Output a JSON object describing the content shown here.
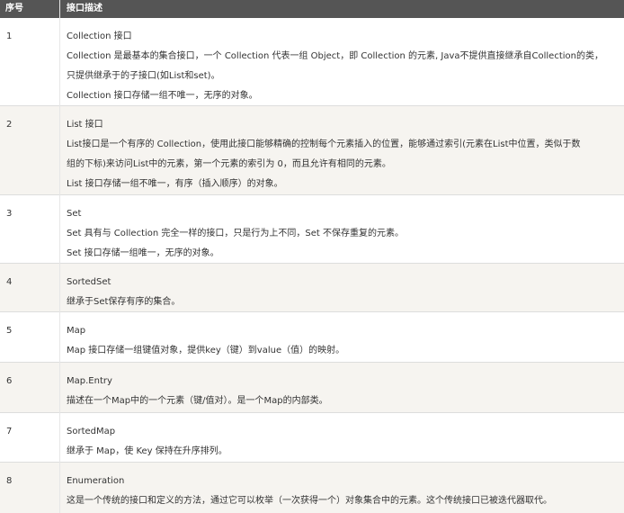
{
  "header": {
    "col_index": "序号",
    "col_desc": "接口描述"
  },
  "rows": [
    {
      "index": "1",
      "name": "Collection 接口",
      "lines": [
        "Collection 是最基本的集合接口，一个 Collection 代表一组 Object，即 Collection 的元素, Java不提供直接继承自Collection的类，",
        "只提供继承于的子接口(如List和set)。",
        "Collection 接口存储一组不唯一，无序的对象。"
      ]
    },
    {
      "index": "2",
      "name": "List 接口",
      "lines": [
        "List接口是一个有序的 Collection，使用此接口能够精确的控制每个元素插入的位置，能够通过索引(元素在List中位置，类似于数",
        "组的下标)来访问List中的元素，第一个元素的索引为 0，而且允许有相同的元素。",
        "List 接口存储一组不唯一，有序（插入顺序）的对象。"
      ]
    },
    {
      "index": "3",
      "name": "Set",
      "lines": [
        "Set 具有与 Collection 完全一样的接口，只是行为上不同，Set 不保存重复的元素。",
        "Set 接口存储一组唯一，无序的对象。"
      ]
    },
    {
      "index": "4",
      "name": "SortedSet",
      "lines": [
        "继承于Set保存有序的集合。"
      ]
    },
    {
      "index": "5",
      "name": "Map",
      "lines": [
        "Map 接口存储一组键值对象，提供key（键）到value（值）的映射。"
      ]
    },
    {
      "index": "6",
      "name": "Map.Entry",
      "lines": [
        "描述在一个Map中的一个元素（键/值对）。是一个Map的内部类。"
      ]
    },
    {
      "index": "7",
      "name": "SortedMap",
      "lines": [
        "继承于 Map，使 Key 保持在升序排列。"
      ]
    },
    {
      "index": "8",
      "name": "Enumeration",
      "lines": [
        "这是一个传统的接口和定义的方法，通过它可以枚举（一次获得一个）对象集合中的元素。这个传统接口已被迭代器取代。"
      ]
    }
  ]
}
